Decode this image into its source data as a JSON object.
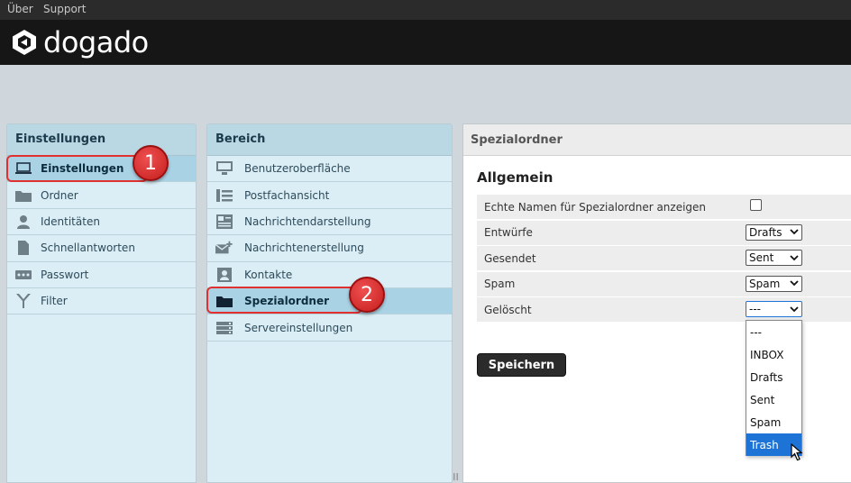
{
  "topbar": {
    "about": "Über",
    "support": "Support"
  },
  "brand": {
    "name": "dogado"
  },
  "panel1": {
    "title": "Einstellungen",
    "items": [
      {
        "label": "Einstellungen",
        "icon": "laptop-icon",
        "selected": true
      },
      {
        "label": "Ordner",
        "icon": "folder-icon"
      },
      {
        "label": "Identitäten",
        "icon": "person-icon"
      },
      {
        "label": "Schnellantworten",
        "icon": "document-icon"
      },
      {
        "label": "Passwort",
        "icon": "password-icon"
      },
      {
        "label": "Filter",
        "icon": "filter-icon"
      }
    ]
  },
  "panel2": {
    "title": "Bereich",
    "items": [
      {
        "label": "Benutzeroberfläche",
        "icon": "monitor-icon"
      },
      {
        "label": "Postfachansicht",
        "icon": "list-view-icon"
      },
      {
        "label": "Nachrichtendarstellung",
        "icon": "message-display-icon"
      },
      {
        "label": "Nachrichtenerstellung",
        "icon": "compose-mail-icon"
      },
      {
        "label": "Kontakte",
        "icon": "contacts-icon"
      },
      {
        "label": "Spezialordner",
        "icon": "folder-icon",
        "selected": true
      },
      {
        "label": "Servereinstellungen",
        "icon": "server-icon"
      }
    ]
  },
  "badges": {
    "one": "1",
    "two": "2"
  },
  "panel3": {
    "title": "Spezialordner",
    "section": "Allgemein",
    "rows": [
      {
        "label": "Echte Namen für Spezialordner anzeigen",
        "control": "checkbox"
      },
      {
        "label": "Entwürfe",
        "value": "Drafts"
      },
      {
        "label": "Gesendet",
        "value": "Sent"
      },
      {
        "label": "Spam",
        "value": "Spam"
      },
      {
        "label": "Gelöscht",
        "value": "---"
      }
    ],
    "save_label": "Speichern"
  },
  "dropdown_options": [
    "---",
    "INBOX",
    "Drafts",
    "Sent",
    "Spam",
    "Trash"
  ],
  "dropdown_highlighted": "Trash",
  "colors": {
    "accent": "#1e73d6",
    "selected_row": "#a9d2e4",
    "badge": "#d42626"
  }
}
